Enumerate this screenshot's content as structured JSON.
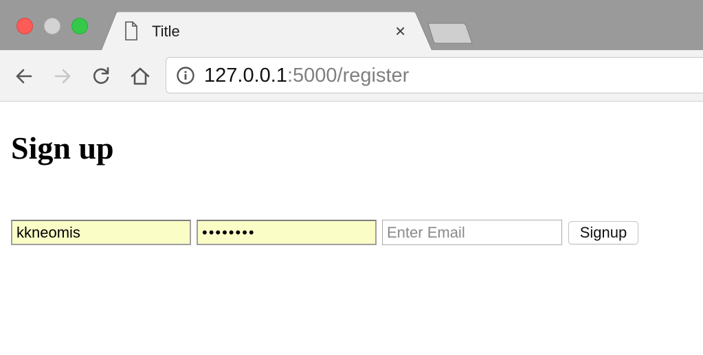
{
  "browser": {
    "tab": {
      "title": "Title",
      "close_symbol": "×"
    },
    "address_bar": {
      "host": "127.0.0.1",
      "rest": ":5000/register"
    },
    "icons": {
      "back": "arrow-left-icon",
      "forward": "arrow-right-icon",
      "reload": "reload-icon",
      "home": "home-icon",
      "info": "info-icon",
      "tab_page": "document-icon"
    },
    "traffic_lights": {
      "close": "#fc5b57",
      "minimize": "#d3d3d3",
      "maximize": "#35c94a"
    }
  },
  "page": {
    "heading": "Sign up",
    "form": {
      "username_value": "kkneomis",
      "password_value": "••••••••",
      "email_placeholder": "Enter Email",
      "email_value": "",
      "submit_label": "Signup",
      "autofill_color": "#fafdc6"
    }
  }
}
